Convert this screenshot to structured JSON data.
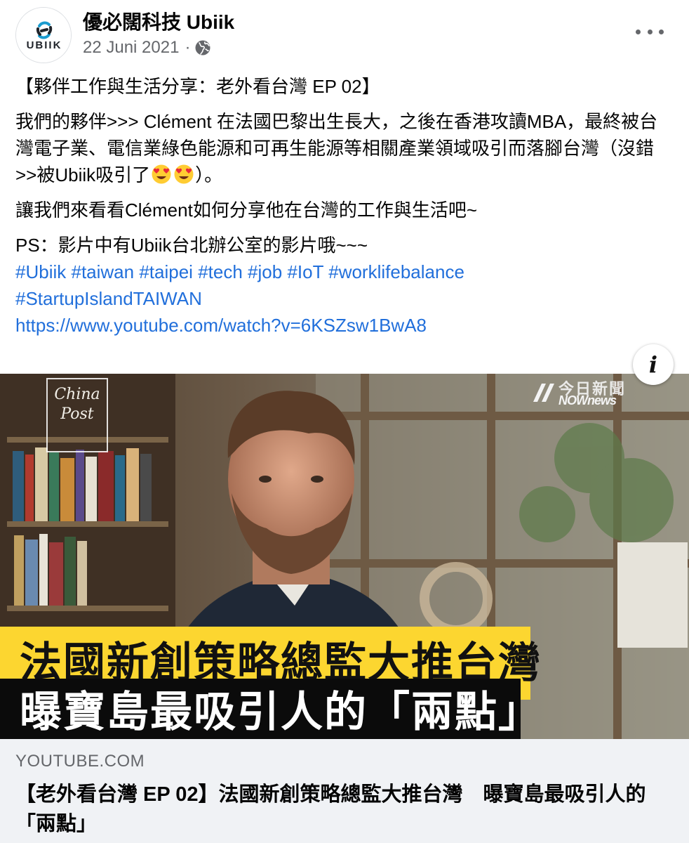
{
  "post": {
    "page_name": "優必闊科技 Ubiik",
    "avatar_text": "UBIIK",
    "date": "22 Juni 2021",
    "separator": "·",
    "privacy_icon": "globe-icon",
    "menu_icon": "more-horizontal-icon"
  },
  "body": {
    "title": "【夥伴工作與生活分享：老外看台灣 EP 02】",
    "para1": "我們的夥伴>>> Clément 在法國巴黎出生長大，之後在香港攻讀MBA，最終被台灣電子業、電信業綠色能源和可再生能源等相關產業領域吸引而落腳台灣（沒錯>>被Ubiik吸引了",
    "para1_emoji": "smiling-face-with-heart-eyes-emoji",
    "para1_end": "）。",
    "para2": "讓我們來看看Clément如何分享他在台灣的工作與生活吧~",
    "para3": "PS：影片中有Ubiik台北辦公室的影片哦~~~",
    "hashtags": [
      "#Ubiik",
      "#taiwan",
      "#taipei",
      "#tech",
      "#job",
      "#IoT",
      "#worklifebalance",
      "#StartupIslandTAIWAN"
    ],
    "url": "https://www.youtube.com/watch?v=6KSZsw1BwA8"
  },
  "preview": {
    "logo_left_line1": "China",
    "logo_left_line2": "Post",
    "logo_right_zh": "今日新聞",
    "logo_right_en": "NOWnews",
    "caption_line1": "法國新創策略總監大推台灣",
    "caption_line2": "曝寶島最吸引人的「兩點」",
    "info_label": "i"
  },
  "link": {
    "domain": "YOUTUBE.COM",
    "title": "【老外看台灣 EP 02】法國新創策略總監大推台灣　曝寶島最吸引人的「兩點」"
  },
  "colors": {
    "link_blue": "#216fdb",
    "meta_gray": "#65676b",
    "caption_yellow": "#fcd630",
    "footer_bg": "#f0f2f5"
  }
}
